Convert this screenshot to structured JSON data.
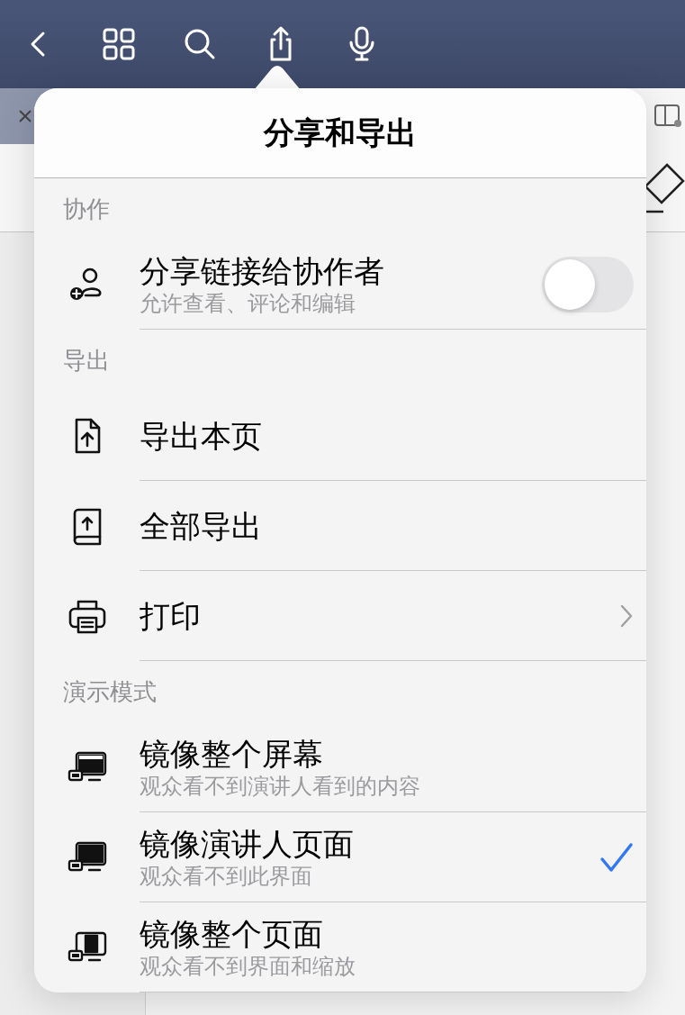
{
  "popover": {
    "title": "分享和导出",
    "sections": [
      {
        "header": "协作",
        "items": [
          {
            "kind": "toggle",
            "title": "分享链接给协作者",
            "subtitle": "允许查看、评论和编辑",
            "on": false
          }
        ]
      },
      {
        "header": "导出",
        "items": [
          {
            "kind": "plain",
            "title": "导出本页"
          },
          {
            "kind": "plain",
            "title": "全部导出"
          },
          {
            "kind": "disclosure",
            "title": "打印"
          }
        ]
      },
      {
        "header": "演示模式",
        "items": [
          {
            "kind": "option",
            "title": "镜像整个屏幕",
            "subtitle": "观众看不到演讲人看到的内容",
            "selected": false
          },
          {
            "kind": "option",
            "title": "镜像演讲人页面",
            "subtitle": "观众看不到此界面",
            "selected": true
          },
          {
            "kind": "option",
            "title": "镜像整个页面",
            "subtitle": "观众看不到界面和缩放",
            "selected": false
          }
        ]
      }
    ]
  }
}
